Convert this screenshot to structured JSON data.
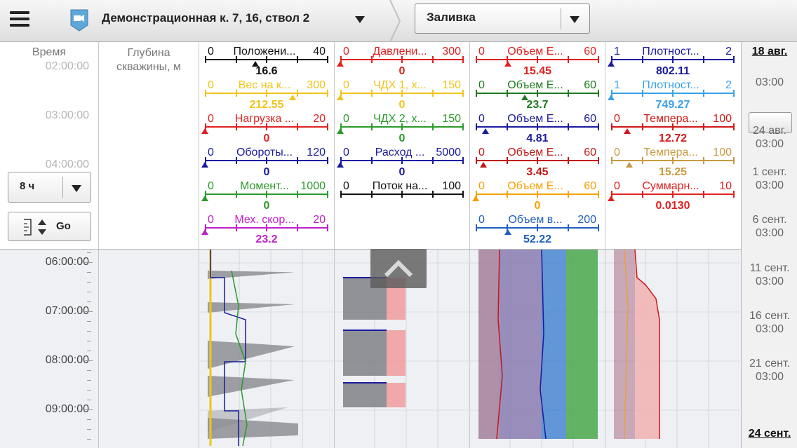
{
  "topbar": {
    "well_title": "Демонстрационная к. 7, 16, ствол 2",
    "mode": "Заливка"
  },
  "columns": {
    "time_header": "Время",
    "depth_header": "Глубина скважины, м"
  },
  "time_axis": {
    "faded_labels": [
      "02:00:00",
      "03:00:00",
      "04:00:00"
    ],
    "labels": [
      "06:00:00",
      "07:00:00",
      "08:00:00",
      "09:00:00"
    ]
  },
  "controls": {
    "range_value": "8 ч",
    "go_label": "Go"
  },
  "tracks": [
    {
      "curves": [
        {
          "min": "0",
          "max": "40",
          "name": "Положени...",
          "value": "16.6",
          "color": "#111111",
          "marker": 0.41
        },
        {
          "min": "0",
          "max": "300",
          "name": "Вес на к...",
          "value": "212.55",
          "color": "#f0c419",
          "marker": 0.71
        },
        {
          "min": "0",
          "max": "20",
          "name": "Нагрузка ...",
          "value": "0",
          "color": "#e02020",
          "marker": 0
        },
        {
          "min": "0",
          "max": "120",
          "name": "Обороты...",
          "value": "0",
          "color": "#1a1aa0",
          "marker": 0
        },
        {
          "min": "0",
          "max": "1000",
          "name": "Момент...",
          "value": "0",
          "color": "#2a9a2a",
          "marker": 0
        },
        {
          "min": "0",
          "max": "20",
          "name": "Мех. скор...",
          "value": "23.2",
          "color": "#c020c8",
          "marker": 0
        }
      ]
    },
    {
      "curves": [
        {
          "min": "0",
          "max": "300",
          "name": "Давлени...",
          "value": "0",
          "color": "#e02020",
          "marker": 0
        },
        {
          "min": "0",
          "max": "150",
          "name": "ЧДХ 1, х...",
          "value": "0",
          "color": "#f0c419",
          "marker": 0
        },
        {
          "min": "0",
          "max": "150",
          "name": "ЧДХ 2, х...",
          "value": "0",
          "color": "#2a9a2a",
          "marker": 0
        },
        {
          "min": "0",
          "max": "5000",
          "name": "Расход ...",
          "value": "0",
          "color": "#1a1aa0",
          "marker": 0
        },
        {
          "min": "0",
          "max": "100",
          "name": "Поток на...",
          "value": "",
          "color": "#111111",
          "marker": 0
        }
      ]
    },
    {
      "curves": [
        {
          "min": "0",
          "max": "60",
          "name": "Объем Е...",
          "value": "15.45",
          "color": "#e02020",
          "marker": 0.26
        },
        {
          "min": "0",
          "max": "60",
          "name": "Объем Е...",
          "value": "23.7",
          "color": "#1f7a1f",
          "marker": 0.4
        },
        {
          "min": "0",
          "max": "60",
          "name": "Объем Е...",
          "value": "4.81",
          "color": "#1a1aa0",
          "marker": 0.08
        },
        {
          "min": "0",
          "max": "60",
          "name": "Объем Е...",
          "value": "3.45",
          "color": "#c01818",
          "marker": 0.06
        },
        {
          "min": "0",
          "max": "60",
          "name": "Объем Е...",
          "value": "0",
          "color": "#f5a000",
          "marker": 0
        },
        {
          "min": "0",
          "max": "200",
          "name": "Объем в...",
          "value": "52.22",
          "color": "#2060c0",
          "marker": 0.26
        }
      ]
    },
    {
      "curves": [
        {
          "min": "1",
          "max": "2",
          "name": "Плотност...",
          "value": "802.11",
          "color": "#1a1aa0",
          "marker": 0
        },
        {
          "min": "1",
          "max": "2",
          "name": "Плотност...",
          "value": "749.27",
          "color": "#3aa0e8",
          "marker": 0
        },
        {
          "min": "0",
          "max": "100",
          "name": "Темпера...",
          "value": "12.72",
          "color": "#d01818",
          "marker": 0.13
        },
        {
          "min": "0",
          "max": "100",
          "name": "Темпера...",
          "value": "15.25",
          "color": "#c89a40",
          "marker": 0.15
        },
        {
          "min": "0",
          "max": "10",
          "name": "Суммарн...",
          "value": "0.0130",
          "color": "#e02020",
          "marker": 0
        }
      ]
    }
  ],
  "date_axis": {
    "top_date": "18 авг.",
    "bottom_date": "24 сент.",
    "labels": [
      {
        "date": "",
        "time": "03:00"
      },
      {
        "date": "24 авг.",
        "time": "03:00"
      },
      {
        "date": "1 сент.",
        "time": "03:00"
      },
      {
        "date": "6 сент.",
        "time": "03:00"
      },
      {
        "date": "11 сент.",
        "time": "03:00"
      },
      {
        "date": "16 сент.",
        "time": "03:00"
      },
      {
        "date": "21 сент.",
        "time": "03:00"
      }
    ]
  }
}
